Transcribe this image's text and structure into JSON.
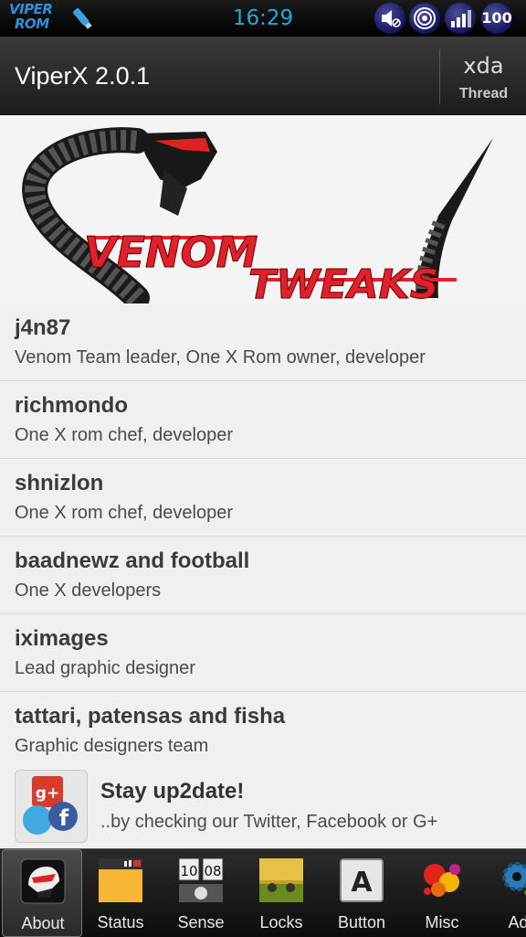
{
  "status_bar": {
    "brand_line1": "VIPER",
    "brand_line2": "ROM",
    "time": "16:29",
    "battery": "100",
    "icons": [
      "usb-icon",
      "sound-mute-icon",
      "wifi-icon",
      "signal-icon",
      "battery-icon"
    ]
  },
  "action_bar": {
    "title": "ViperX 2.0.1",
    "xda_logo": "xda",
    "xda_label": "Thread"
  },
  "banner": {
    "line1": "VENOM",
    "line2": "TWEAKS"
  },
  "credits": [
    {
      "name": "j4n87",
      "role": "Venom Team leader, One X Rom owner, developer"
    },
    {
      "name": "richmondo",
      "role": "One X rom chef, developer"
    },
    {
      "name": "shnizlon",
      "role": "One X rom chef, developer"
    },
    {
      "name": "baadnewz and football",
      "role": "One X developers"
    },
    {
      "name": "iximages",
      "role": "Lead graphic designer"
    },
    {
      "name": "tattari, patensas and fisha",
      "role": "Graphic designers team"
    }
  ],
  "social": {
    "title": "Stay up2date!",
    "subtitle": "..by checking our Twitter, Facebook or G+",
    "icon_text": "g+"
  },
  "tabs": [
    {
      "label": "About",
      "icon": "venom-helmet-icon",
      "active": true
    },
    {
      "label": "Status",
      "icon": "status-bar-icon",
      "active": false
    },
    {
      "label": "Sense",
      "icon": "clock-widget-icon",
      "active": false
    },
    {
      "label": "Locks",
      "icon": "lockscreen-icon",
      "active": false
    },
    {
      "label": "Button",
      "icon": "letter-button-icon",
      "active": false,
      "icon_text": "A"
    },
    {
      "label": "Misc",
      "icon": "paint-splash-icon",
      "active": false
    },
    {
      "label": "Adv",
      "icon": "gears-icon",
      "active": false
    }
  ],
  "colors": {
    "clock": "#27a9d6",
    "brand": "#2f8fd8",
    "banner_red": "#e0202a"
  }
}
